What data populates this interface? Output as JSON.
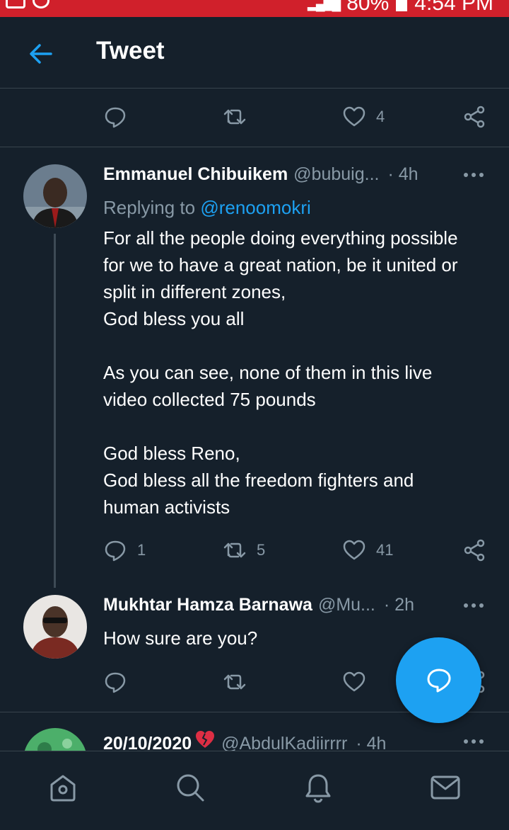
{
  "status_bar": {
    "battery": "80%",
    "time": "4:54 PM"
  },
  "header": {
    "title": "Tweet"
  },
  "top_actions": {
    "likes": "4"
  },
  "tweets": [
    {
      "name": "Emmanuel Chibuikem",
      "handle": "@bubuig...",
      "time": "· 4h",
      "replying_label": "Replying to",
      "replying_to": "@renoomokri",
      "text": "For all the people doing everything possible\nfor we to have a great nation, be it united or\nsplit in different zones,\nGod bless you all\n\nAs you can see, none of them in this live\nvideo collected 75 pounds\n\nGod bless Reno,\nGod bless all the freedom fighters and\nhuman activists",
      "replies": "1",
      "retweets": "5",
      "likes": "41"
    },
    {
      "name": "Mukhtar Hamza Barnawa",
      "handle": "@Mu...",
      "time": "· 2h",
      "text": "How sure are you?"
    },
    {
      "name": "20/10/2020",
      "name_emoji": "broken-heart",
      "handle": "@AbdulKadiirrrr",
      "time": "· 4h"
    }
  ],
  "colors": {
    "background": "#15202b",
    "accent": "#1da1f2",
    "muted": "#8899a6",
    "divider": "#38444d",
    "status_bar": "#d0202b"
  },
  "icons": {
    "back": "arrow-left-icon",
    "reply": "speech-bubble-icon",
    "retweet": "retweet-icon",
    "like": "heart-icon",
    "share": "share-icon",
    "more": "more-dots-icon",
    "compose": "compose-reply-icon",
    "nav": [
      "home-icon",
      "search-icon",
      "notifications-icon",
      "messages-icon"
    ]
  }
}
